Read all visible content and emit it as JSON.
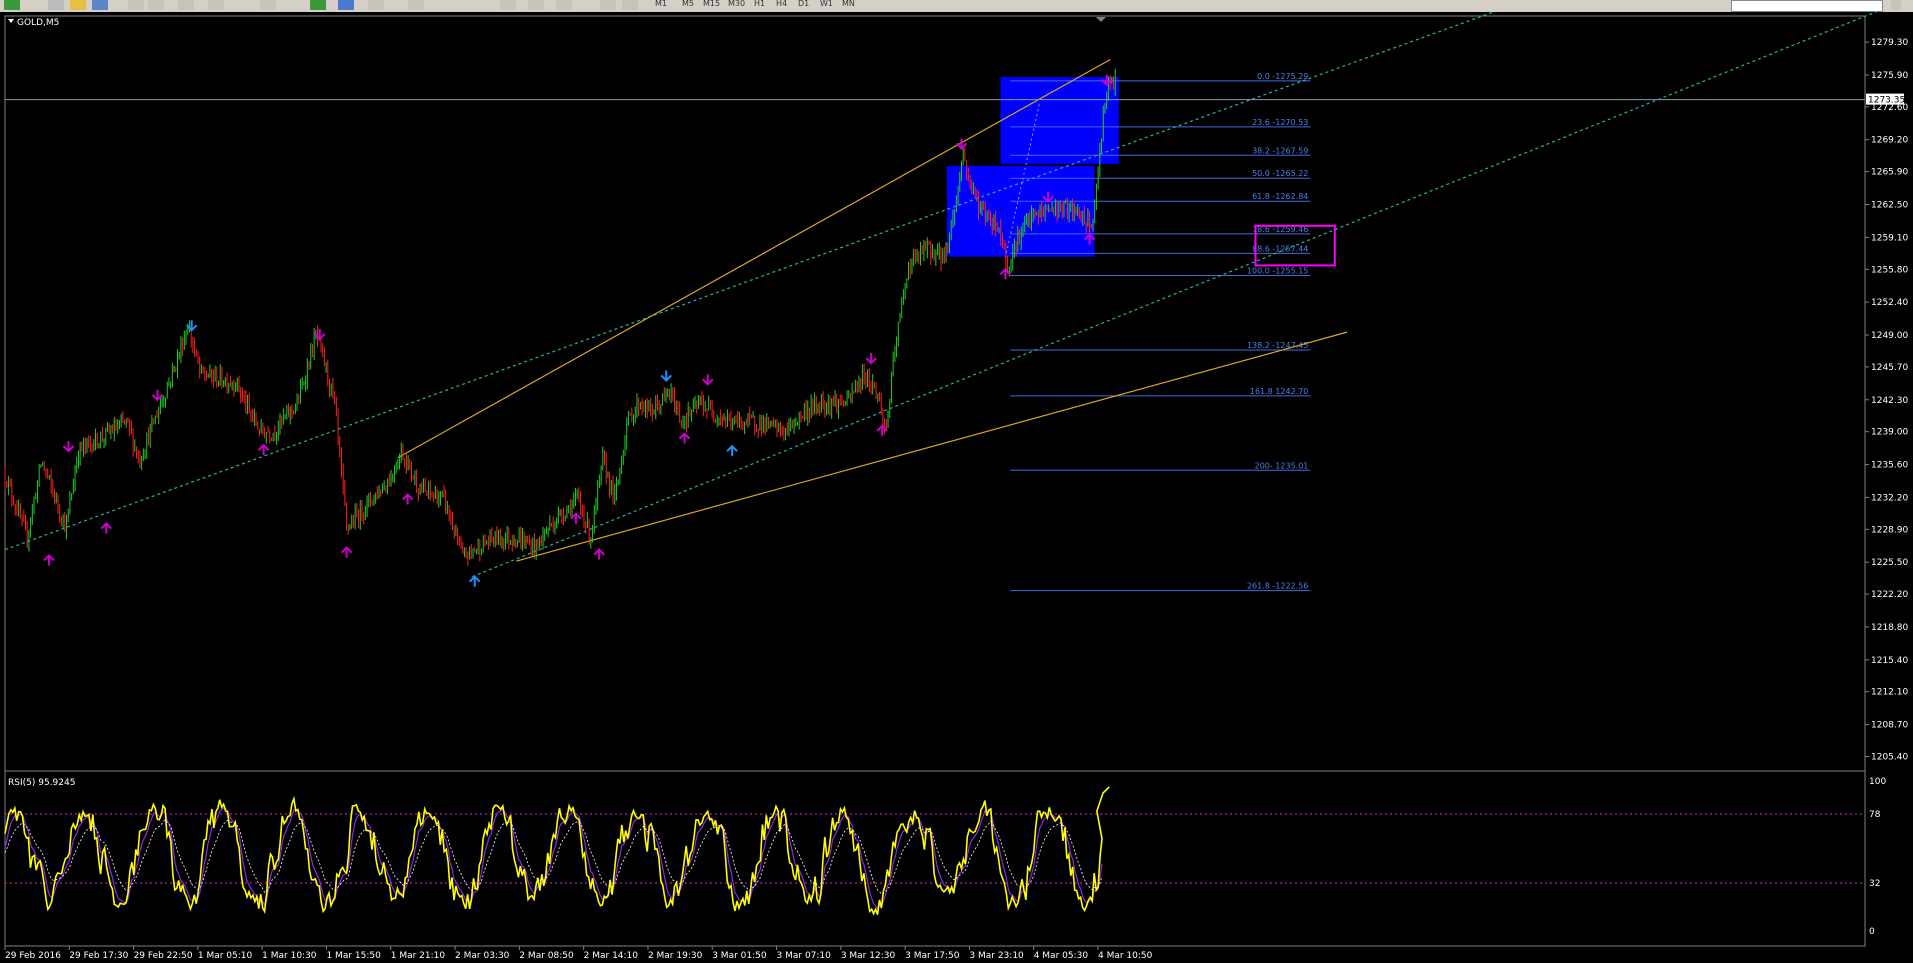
{
  "toolbar": {
    "timeframes": [
      "M1",
      "M5",
      "M15",
      "M30",
      "H1",
      "H4",
      "D1",
      "W1",
      "MN"
    ]
  },
  "chart_data": [
    {
      "type": "candlestick",
      "title": "GOLD,M5",
      "current_price_label": "1273.35",
      "ylim": [
        1203.9,
        1282.0
      ],
      "y_ticks": [
        "1279.30",
        "1275.90",
        "1272.60",
        "1269.20",
        "1265.90",
        "1262.50",
        "1259.10",
        "1255.80",
        "1252.40",
        "1249.00",
        "1245.70",
        "1242.30",
        "1239.00",
        "1235.60",
        "1232.20",
        "1228.90",
        "1225.50",
        "1222.20",
        "1218.80",
        "1215.40",
        "1212.10",
        "1208.70",
        "1205.40"
      ],
      "x_ticks": [
        "29 Feb 2016",
        "29 Feb 17:30",
        "29 Feb 22:50",
        "1 Mar 05:10",
        "1 Mar 10:30",
        "1 Mar 15:50",
        "1 Mar 21:10",
        "2 Mar 03:30",
        "2 Mar 08:50",
        "2 Mar 14:10",
        "2 Mar 19:30",
        "3 Mar 01:50",
        "3 Mar 07:10",
        "3 Mar 12:30",
        "3 Mar 17:50",
        "3 Mar 23:10",
        "4 Mar 05:30",
        "4 Mar 10:50"
      ],
      "price_path": [
        [
          0,
          1234.5
        ],
        [
          18,
          1228
        ],
        [
          30,
          1236
        ],
        [
          50,
          1229
        ],
        [
          60,
          1237
        ],
        [
          100,
          1240
        ],
        [
          110,
          1236
        ],
        [
          140,
          1246
        ],
        [
          150,
          1250
        ],
        [
          160,
          1245
        ],
        [
          190,
          1244
        ],
        [
          200,
          1241
        ],
        [
          210,
          1239
        ],
        [
          220,
          1239
        ],
        [
          240,
          1242
        ],
        [
          255,
          1249
        ],
        [
          262,
          1246
        ],
        [
          270,
          1242
        ],
        [
          280,
          1229
        ],
        [
          300,
          1232
        ],
        [
          315,
          1234
        ],
        [
          325,
          1237
        ],
        [
          340,
          1233
        ],
        [
          360,
          1232
        ],
        [
          375,
          1226
        ],
        [
          400,
          1228
        ],
        [
          420,
          1228
        ],
        [
          435,
          1227
        ],
        [
          445,
          1229
        ],
        [
          460,
          1231
        ],
        [
          470,
          1232
        ],
        [
          480,
          1228
        ],
        [
          490,
          1236
        ],
        [
          500,
          1232
        ],
        [
          510,
          1240
        ],
        [
          520,
          1242
        ],
        [
          530,
          1241
        ],
        [
          545,
          1243
        ],
        [
          555,
          1240
        ],
        [
          570,
          1242
        ],
        [
          580,
          1241
        ],
        [
          595,
          1240
        ],
        [
          615,
          1240
        ],
        [
          640,
          1239
        ],
        [
          655,
          1241
        ],
        [
          670,
          1242
        ],
        [
          690,
          1242
        ],
        [
          705,
          1245
        ],
        [
          715,
          1243
        ],
        [
          722,
          1239
        ],
        [
          730,
          1248
        ],
        [
          740,
          1256
        ],
        [
          755,
          1258
        ],
        [
          770,
          1257
        ],
        [
          780,
          1263
        ],
        [
          785,
          1268
        ],
        [
          790,
          1265
        ],
        [
          800,
          1262
        ],
        [
          815,
          1260
        ],
        [
          822,
          1256
        ],
        [
          830,
          1259
        ],
        [
          840,
          1261
        ],
        [
          855,
          1262
        ],
        [
          870,
          1262
        ],
        [
          885,
          1261
        ],
        [
          890,
          1260
        ],
        [
          895,
          1264
        ],
        [
          900,
          1272
        ],
        [
          905,
          1275
        ],
        [
          910,
          1275
        ]
      ],
      "fibonacci": [
        {
          "label": "0.0 -1275.29",
          "value": 1275.29
        },
        {
          "label": "23.6 -1270.53",
          "value": 1270.53
        },
        {
          "label": "38.2 -1267.59",
          "value": 1267.59
        },
        {
          "label": "50.0 -1265.22",
          "value": 1265.22
        },
        {
          "label": "61.8 -1262.84",
          "value": 1262.84
        },
        {
          "label": "78.6 -1259.46",
          "value": 1259.46
        },
        {
          "label": "88.6 -1257.44",
          "value": 1257.44
        },
        {
          "label": "100.0 -1255.15",
          "value": 1255.15
        },
        {
          "label": "138.2 -1247.45",
          "value": 1247.45
        },
        {
          "label": "161.8 1242.70",
          "value": 1242.7
        },
        {
          "label": "200- 1235.01",
          "value": 1235.01
        },
        {
          "label": "261.8 -1222.56",
          "value": 1222.56
        }
      ],
      "arrows_up": [
        [
          36,
          1226.2
        ],
        [
          83,
          1229.5
        ],
        [
          212,
          1237.6
        ],
        [
          280,
          1227
        ],
        [
          330,
          1232.5
        ],
        [
          385,
          1224
        ],
        [
          468,
          1230.5
        ],
        [
          487,
          1226.8
        ],
        [
          557,
          1238.8
        ],
        [
          596,
          1237.5
        ],
        [
          719,
          1239.6
        ],
        [
          820,
          1255.8
        ],
        [
          889,
          1259.4
        ]
      ],
      "arrows_down": [
        [
          52,
          1237
        ],
        [
          125,
          1242.3
        ],
        [
          153,
          1249.5
        ],
        [
          258,
          1248.6
        ],
        [
          542,
          1244.3
        ],
        [
          576,
          1243.9
        ],
        [
          710,
          1246.1
        ],
        [
          784,
          1268.3
        ],
        [
          855,
          1262.8
        ],
        [
          903,
          1274.9
        ]
      ],
      "colors": {
        "bull": "#22cc22",
        "bear": "#ff2020",
        "fib": "#4169e1",
        "channel": "#20b2aa",
        "trend": "#daa520",
        "box": "#0000ff",
        "highlight": "#ff00ff",
        "arrow_up_blue": "#1e90ff",
        "arrow_magenta": "#cc00cc"
      }
    },
    {
      "type": "line",
      "title": "RSI(5) 95.9245",
      "ylim": [
        0,
        100
      ],
      "y_ticks": [
        "100",
        "78",
        "32",
        "0"
      ],
      "levels": [
        78,
        32
      ],
      "colors": {
        "rsi": "#ffff00",
        "signal": "#8a2be2",
        "level": "#cc33cc"
      }
    }
  ]
}
